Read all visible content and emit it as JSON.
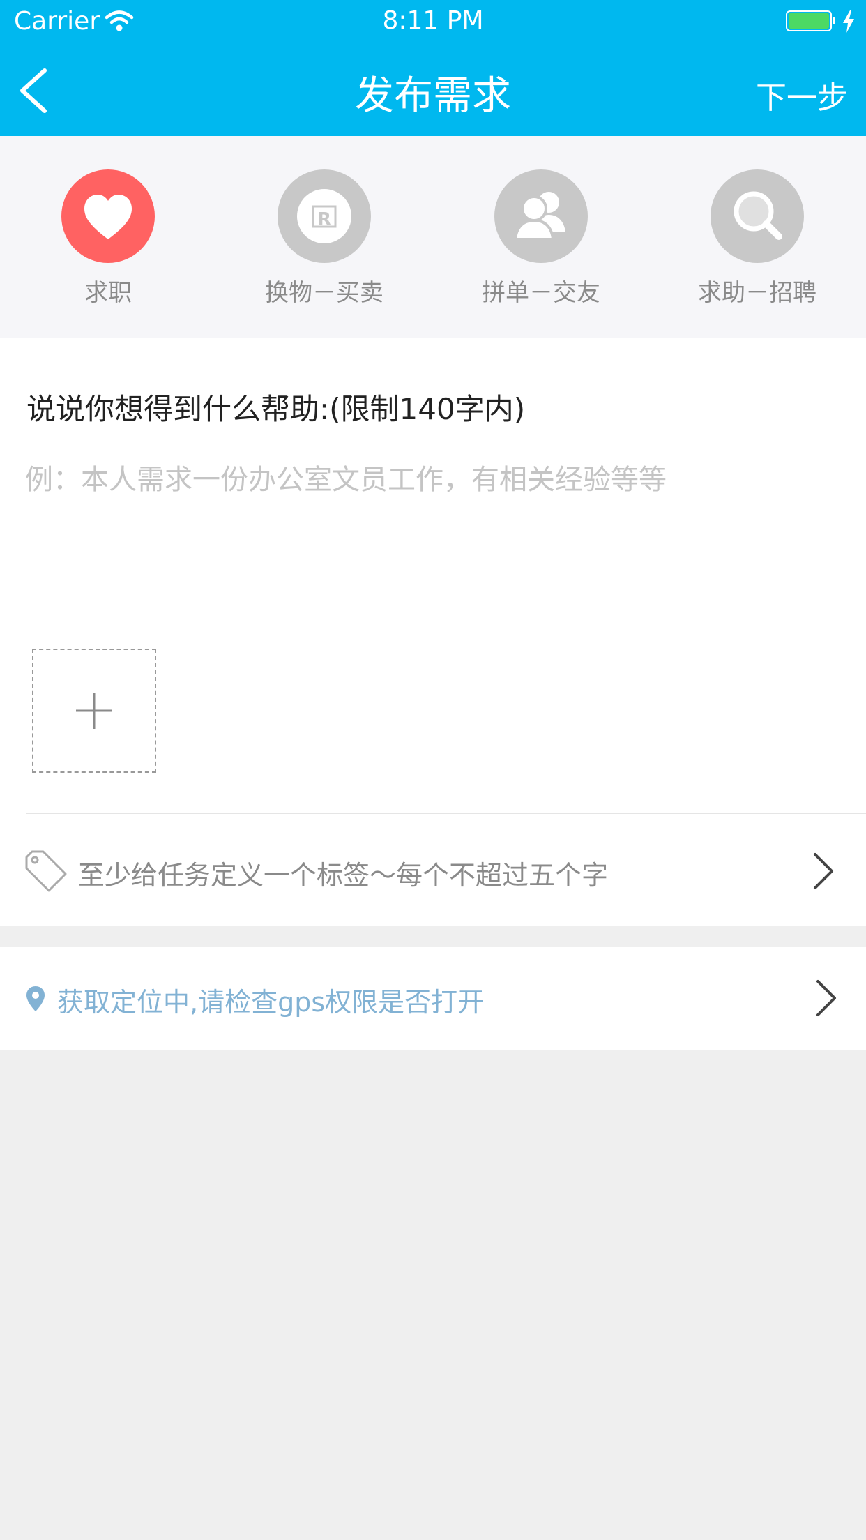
{
  "status_bar": {
    "carrier": "Carrier",
    "time": "8:11 PM",
    "icons": [
      "wifi-icon",
      "battery-icon",
      "charging-icon"
    ]
  },
  "nav": {
    "title": "发布需求",
    "next_label": "下一步",
    "back_icon": "chevron-left-icon"
  },
  "categories": [
    {
      "label": "求职",
      "icon": "heart-icon",
      "active": true
    },
    {
      "label": "换物－买卖",
      "icon": "r-badge-icon",
      "active": false
    },
    {
      "label": "拼单－交友",
      "icon": "people-icon",
      "active": false
    },
    {
      "label": "求助－招聘",
      "icon": "search-icon",
      "active": false
    }
  ],
  "form": {
    "prompt": "说说你想得到什么帮助:(限制140字内)",
    "placeholder": "例：本人需求一份办公室文员工作，有相关经验等等",
    "value": "",
    "add_photo_icon": "plus-icon"
  },
  "tag": {
    "placeholder": "至少给任务定义一个标签～每个不超过五个字",
    "icon": "tag-icon"
  },
  "location": {
    "text": "获取定位中,请检查gps权限是否打开",
    "icon": "location-pin-icon"
  },
  "colors": {
    "brand": "#00b8ef",
    "active_category": "#ff6262",
    "inactive_category": "#c8c8c8",
    "location_text": "#82b2d4",
    "page_background": "#efefef"
  }
}
